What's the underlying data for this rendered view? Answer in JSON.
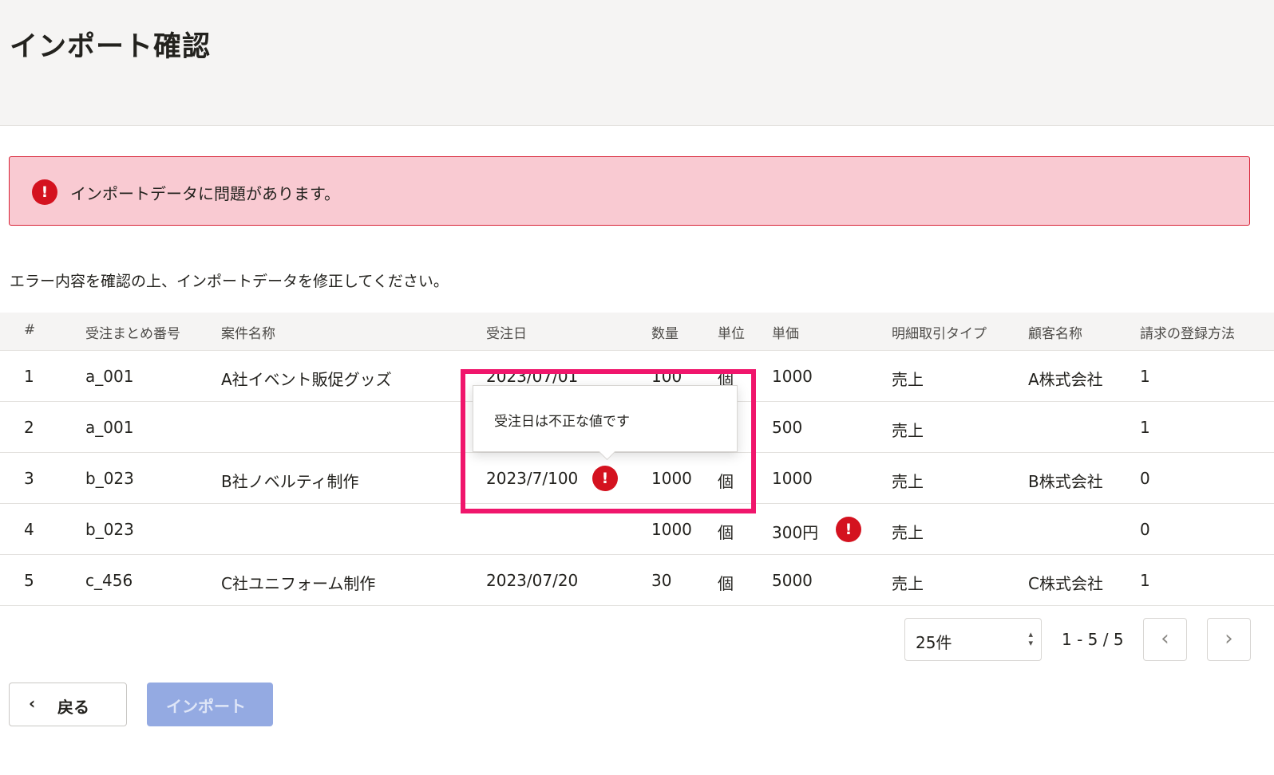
{
  "header": {
    "title": "インポート確認"
  },
  "alert": {
    "message": "インポートデータに問題があります。",
    "icon": "error-icon"
  },
  "instruction": "エラー内容を確認の上、インポートデータを修正してください。",
  "table": {
    "columns": [
      "#",
      "受注まとめ番号",
      "案件名称",
      "受注日",
      "数量",
      "単位",
      "単価",
      "明細取引タイプ",
      "顧客名称",
      "請求の登録方法"
    ],
    "rows": [
      {
        "num": "1",
        "order_group": "a_001",
        "project": "A社イベント販促グッズ",
        "order_date": "2023/07/01",
        "quantity": "100",
        "unit": "個",
        "unit_price": "1000",
        "tx_type": "売上",
        "customer": "A株式会社",
        "billing": "1"
      },
      {
        "num": "2",
        "order_group": "a_001",
        "project": "",
        "order_date": "",
        "quantity": "",
        "unit": "",
        "unit_price": "500",
        "tx_type": "売上",
        "customer": "",
        "billing": "1"
      },
      {
        "num": "3",
        "order_group": "b_023",
        "project": "B社ノベルティ制作",
        "order_date": "2023/7/100",
        "quantity": "1000",
        "unit": "個",
        "unit_price": "1000",
        "tx_type": "売上",
        "customer": "B株式会社",
        "billing": "0"
      },
      {
        "num": "4",
        "order_group": "b_023",
        "project": "",
        "order_date": "",
        "quantity": "1000",
        "unit": "個",
        "unit_price": "300円",
        "tx_type": "売上",
        "customer": "",
        "billing": "0"
      },
      {
        "num": "5",
        "order_group": "c_456",
        "project": "C社ユニフォーム制作",
        "order_date": "2023/07/20",
        "quantity": "30",
        "unit": "個",
        "unit_price": "5000",
        "tx_type": "売上",
        "customer": "C株式会社",
        "billing": "1"
      }
    ]
  },
  "tooltip": {
    "text": "受注日は不正な値です"
  },
  "error_mark": "!",
  "pagination": {
    "per_page": "25件",
    "range": "1 - 5 / 5",
    "prev": "‹",
    "next": "›"
  },
  "actions": {
    "back_icon": "‹",
    "back_label": "戻る",
    "import_label": "インポート"
  },
  "colors": {
    "error": "#d4121f",
    "alert_bg": "#f9cad2",
    "highlight": "#f0166c",
    "primary_disabled": "#94aae2"
  }
}
